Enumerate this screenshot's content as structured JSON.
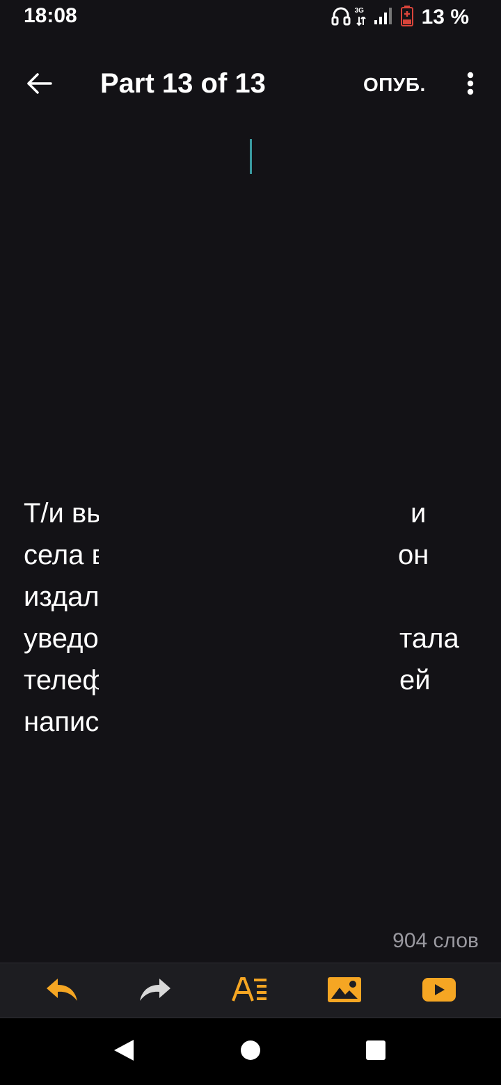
{
  "status_bar": {
    "time": "18:08",
    "network_label": "3G",
    "battery_text": "13 %",
    "icons": [
      "headphones-icon",
      "network-3g-icon",
      "signal-icon",
      "battery-low-icon"
    ]
  },
  "app_bar": {
    "title": "Part 13 of 13",
    "publish_label": "ОПУБ.",
    "back_icon": "arrow-left-icon",
    "more_icon": "more-vertical-icon"
  },
  "story": {
    "lines": [
      {
        "left": "Т/и вы",
        "right": "и"
      },
      {
        "left": "села в",
        "right": "он"
      },
      {
        "left": "издал",
        "right": ""
      },
      {
        "left": "уведо",
        "right": "тала"
      },
      {
        "left": "телеф",
        "right": "ей"
      },
      {
        "left": "напис",
        "right": ""
      }
    ]
  },
  "word_count": "904 слов",
  "toolbar": {
    "accent_color": "#f5a623",
    "items": [
      {
        "name": "undo",
        "icon": "undo-icon"
      },
      {
        "name": "redo",
        "icon": "redo-icon"
      },
      {
        "name": "format",
        "icon": "text-format-icon"
      },
      {
        "name": "image",
        "icon": "image-icon"
      },
      {
        "name": "video",
        "icon": "video-icon"
      }
    ]
  },
  "nav_bar": {
    "items": [
      "back-triangle-icon",
      "home-circle-icon",
      "recents-square-icon"
    ]
  }
}
